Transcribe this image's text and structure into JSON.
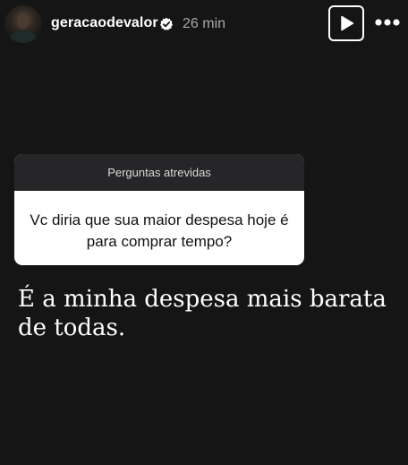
{
  "header": {
    "avatar_icon": "profile-photo",
    "username": "geracaodevalor",
    "verified_icon": "verified-badge-icon",
    "time": "26 min",
    "play_icon": "play-icon",
    "more_icon": "more-dots-icon"
  },
  "question_sticker": {
    "title": "Perguntas atrevidas",
    "question": "Vc diria que sua maior despesa hoje é para comprar tempo?"
  },
  "answer": {
    "text": "É a minha despesa mais barata de todas."
  },
  "colors": {
    "background": "#151515",
    "sticker_header": "#262628",
    "sticker_body": "#ffffff",
    "time_text": "#a8a8a8"
  }
}
